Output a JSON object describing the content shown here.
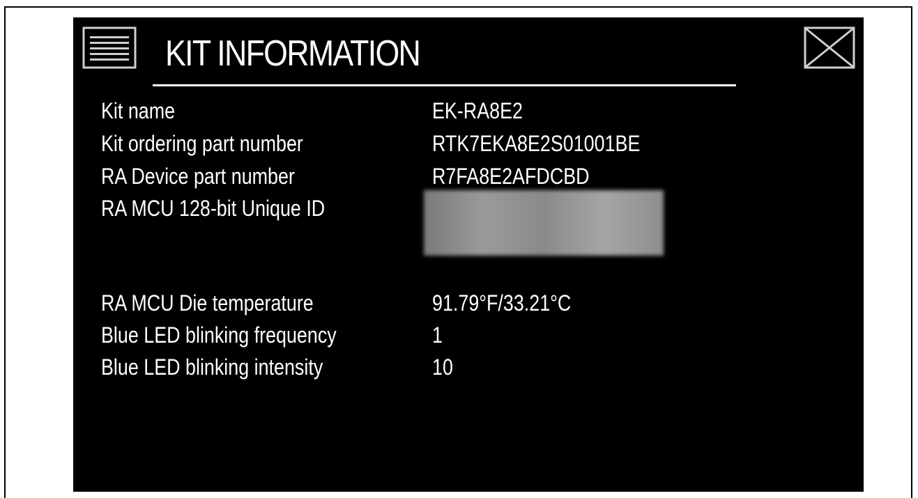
{
  "header": {
    "title": "KIT INFORMATION",
    "menu_icon": "hamburger-menu-icon",
    "close_icon": "close-x-icon"
  },
  "info": {
    "kit_name": {
      "label": "Kit name",
      "value": "EK-RA8E2"
    },
    "kit_part": {
      "label": "Kit ordering part number",
      "value": "RTK7EKA8E2S01001BE"
    },
    "device_part": {
      "label": "RA Device part number",
      "value": "R7FA8E2AFDCBD"
    },
    "unique_id": {
      "label": "RA MCU 128-bit Unique ID",
      "value": ""
    },
    "die_temp": {
      "label": "RA MCU Die temperature",
      "value": "91.79°F/33.21°C"
    },
    "led_freq": {
      "label": "Blue LED blinking frequency",
      "value": "1"
    },
    "led_intensity": {
      "label": "Blue LED blinking intensity",
      "value": "10"
    }
  },
  "colors": {
    "background": "#000000",
    "foreground": "#ffffff"
  }
}
